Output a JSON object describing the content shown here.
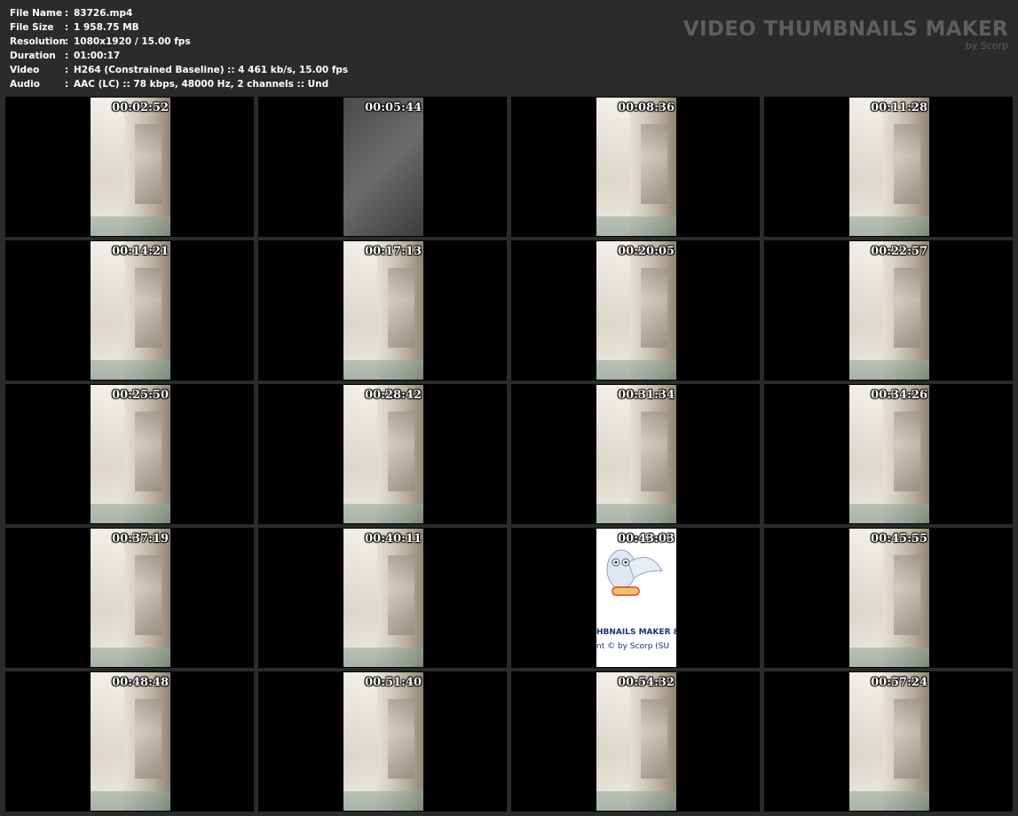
{
  "header": {
    "rows": [
      {
        "label": "File Name",
        "sep": ":",
        "value": "83726.mp4"
      },
      {
        "label": "File Size",
        "sep": ":",
        "value": "1 958.75 MB"
      },
      {
        "label": "Resolution",
        "sep": ":",
        "value": "1080x1920 / 15.00 fps"
      },
      {
        "label": "Duration",
        "sep": ":",
        "value": "01:00:17"
      },
      {
        "label": "Video",
        "sep": ":",
        "value": "H264 (Constrained Baseline) :: 4 461 kb/s, 15.00 fps"
      },
      {
        "label": "Audio",
        "sep": ":",
        "value": "AAC (LC) :: 78 kbps, 48000 Hz, 2 channels :: Und"
      }
    ],
    "brand_title": "VIDEO THUMBNAILS MAKER",
    "brand_sub": "by Scorp"
  },
  "thumbnails": [
    {
      "time": "00:02:52",
      "style": "room"
    },
    {
      "time": "00:05:44",
      "style": "dark"
    },
    {
      "time": "00:08:36",
      "style": "room"
    },
    {
      "time": "00:11:28",
      "style": "room"
    },
    {
      "time": "00:14:21",
      "style": "room"
    },
    {
      "time": "00:17:13",
      "style": "room"
    },
    {
      "time": "00:20:05",
      "style": "room"
    },
    {
      "time": "00:22:57",
      "style": "room"
    },
    {
      "time": "00:25:50",
      "style": "room"
    },
    {
      "time": "00:28:42",
      "style": "room"
    },
    {
      "time": "00:31:34",
      "style": "room"
    },
    {
      "time": "00:34:26",
      "style": "room"
    },
    {
      "time": "00:37:19",
      "style": "room"
    },
    {
      "time": "00:40:11",
      "style": "room"
    },
    {
      "time": "00:43:03",
      "style": "logo",
      "logo_line1": "HBNAILS MAKER 8",
      "logo_line2": "nt © by Scorp (SU"
    },
    {
      "time": "00:45:55",
      "style": "room"
    },
    {
      "time": "00:48:48",
      "style": "room"
    },
    {
      "time": "00:51:40",
      "style": "room"
    },
    {
      "time": "00:54:32",
      "style": "room"
    },
    {
      "time": "00:57:24",
      "style": "room"
    }
  ],
  "colors": {
    "background": "#2b2b2b",
    "cell": "#000000",
    "header_text": "#ffffff",
    "brand": "#5e5e5e"
  }
}
